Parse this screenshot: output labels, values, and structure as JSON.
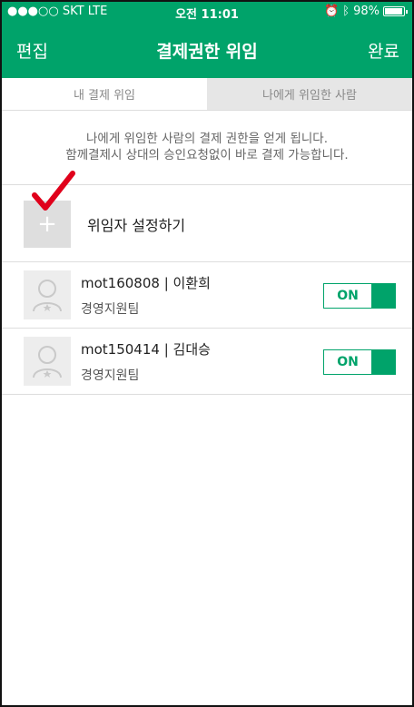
{
  "status_bar": {
    "carrier": "●●●○○ SKT  LTE",
    "time": "오전 11:01",
    "battery": "98%",
    "icons": [
      "alarm-icon",
      "bluetooth-icon",
      "battery-icon"
    ]
  },
  "nav": {
    "edit_label": "편집",
    "title": "결제권한 위임",
    "done_label": "완료"
  },
  "tabs": [
    {
      "label": "내 결제 위임",
      "selected": true
    },
    {
      "label": "나에게 위임한 사람",
      "selected": false
    }
  ],
  "description": {
    "line1": "나에게 위임한 사람의 결제 권한을 얻게 됩니다.",
    "line2": "함께결제시 상대의 승인요청없이 바로 결제 가능합니다."
  },
  "add": {
    "icon_text": "+",
    "label": "위임자 설정하기"
  },
  "delegates": [
    {
      "name": "mot160808 | 이환희",
      "team": "경영지원팀",
      "toggle_label": "ON",
      "enabled": true
    },
    {
      "name": "mot150414 | 김대승",
      "team": "경영지원팀",
      "toggle_label": "ON",
      "enabled": true
    }
  ],
  "colors": {
    "brand_green": "#00a36a",
    "annotation_red": "#e0001b"
  }
}
